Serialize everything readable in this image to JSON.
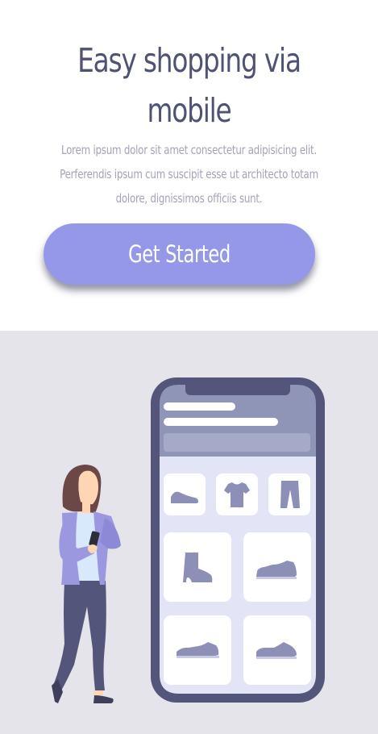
{
  "hero": {
    "title": "Easy shopping via mobile",
    "description": "Lorem ipsum dolor sit amet consectetur adipisicing elit. Perferendis ipsum cum suscipit esse ut architecto totam dolore, dignissimos officiis sunt.",
    "cta_label": "Get Started"
  },
  "illustration": {
    "phone_screen_categories": [
      "flat-shoe-icon",
      "t-shirt-icon",
      "pants-icon",
      "boot-icon",
      "sneaker-icon",
      "sneaker-icon",
      "sneaker-icon"
    ]
  },
  "colors": {
    "title": "#4e5273",
    "description": "#a3a3b8",
    "accent": "#9598e8",
    "illustration_bg": "#e5e4ea",
    "phone_frame": "#54557a",
    "phone_header": "#8e95b7",
    "phone_screen": "#e3e4f6",
    "product_icon": "#8c90b6"
  }
}
